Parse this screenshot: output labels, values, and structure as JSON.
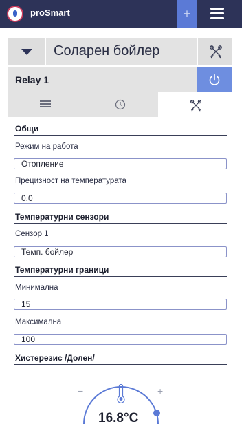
{
  "app": {
    "brand": "proSmart",
    "add_label": "+"
  },
  "device": {
    "title": "Соларен бойлер"
  },
  "relay": {
    "name": "Relay 1"
  },
  "tabs": [
    {
      "icon": "list-icon",
      "active": false
    },
    {
      "icon": "clock-icon",
      "active": false
    },
    {
      "icon": "tools-icon",
      "active": true
    }
  ],
  "sections": {
    "general": {
      "title": "Общи",
      "mode_label": "Режим на работа",
      "mode_value": "Отопление",
      "precision_label": "Прецизност на температурата",
      "precision_value": "0.0"
    },
    "sensors": {
      "title": "Температурни сензори",
      "sensor1_label": "Сензор 1",
      "sensor1_value": "Темп. бойлер"
    },
    "limits": {
      "title": "Температурни граници",
      "min_label": "Минимална",
      "min_value": "15",
      "max_label": "Максимална",
      "max_value": "100"
    },
    "hysteresis": {
      "title": "Хистерезис /Долен/"
    }
  },
  "gauge": {
    "minus": "−",
    "plus": "+",
    "temperature": "16.8°C"
  },
  "colors": {
    "topbar": "#2d3358",
    "accent": "#6e8ee0",
    "logo_ring": "#c73b5c"
  }
}
